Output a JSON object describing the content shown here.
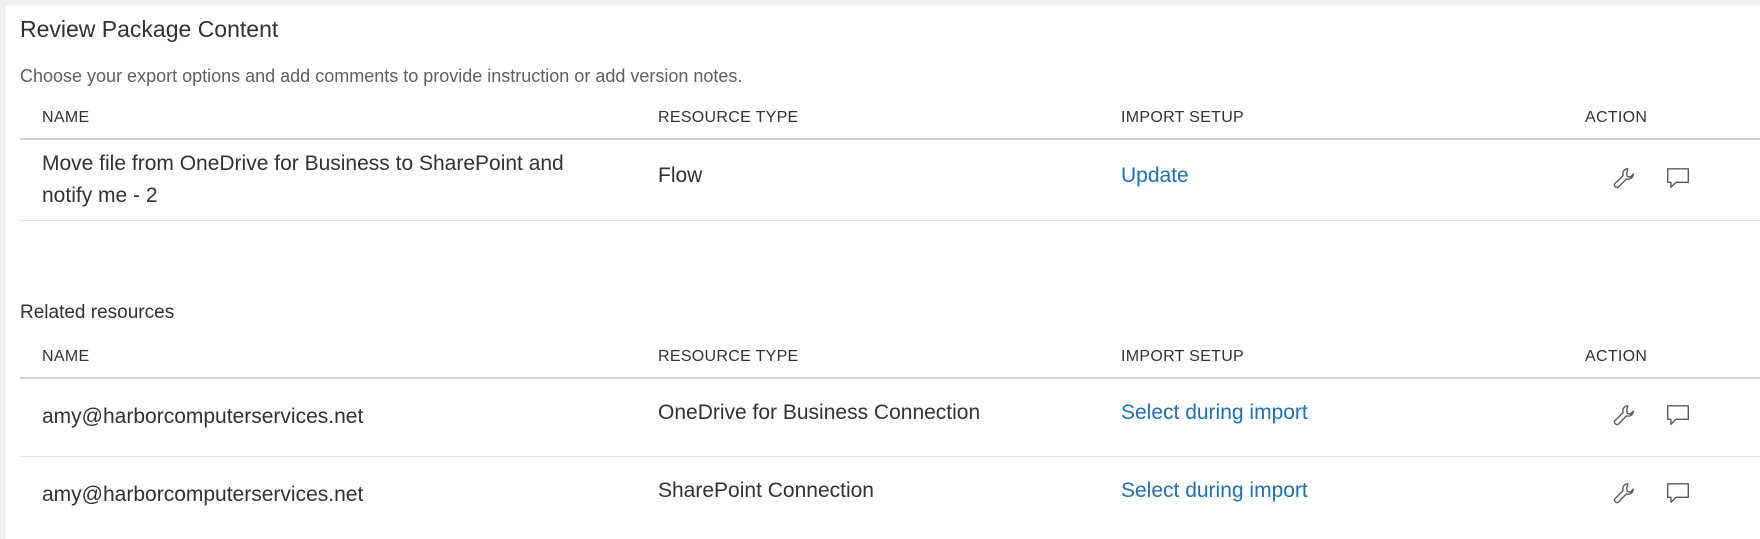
{
  "header": {
    "title": "Review Package Content",
    "subtitle": "Choose your export options and add comments to provide instruction or add version notes."
  },
  "columns": {
    "name": "NAME",
    "resource_type": "RESOURCE TYPE",
    "import_setup": "IMPORT SETUP",
    "action": "ACTION"
  },
  "main_table": {
    "rows": [
      {
        "name_line1": "Move file from OneDrive for Business to SharePoint and",
        "name_line2": "notify me - 2",
        "resource_type": "Flow",
        "import_setup": "Update"
      }
    ]
  },
  "related": {
    "title": "Related resources",
    "rows": [
      {
        "name": "amy@harborcomputerservices.net",
        "resource_type": "OneDrive for Business Connection",
        "import_setup": "Select during import"
      },
      {
        "name": "amy@harborcomputerservices.net",
        "resource_type": "SharePoint Connection",
        "import_setup": "Select during import"
      }
    ]
  },
  "icons": {
    "settings": "wrench-icon",
    "comment": "comment-icon"
  },
  "colors": {
    "link": "#1f6fb6",
    "text": "#323130",
    "muted": "#605e5c",
    "background": "#efefef",
    "panel": "#ffffff"
  }
}
